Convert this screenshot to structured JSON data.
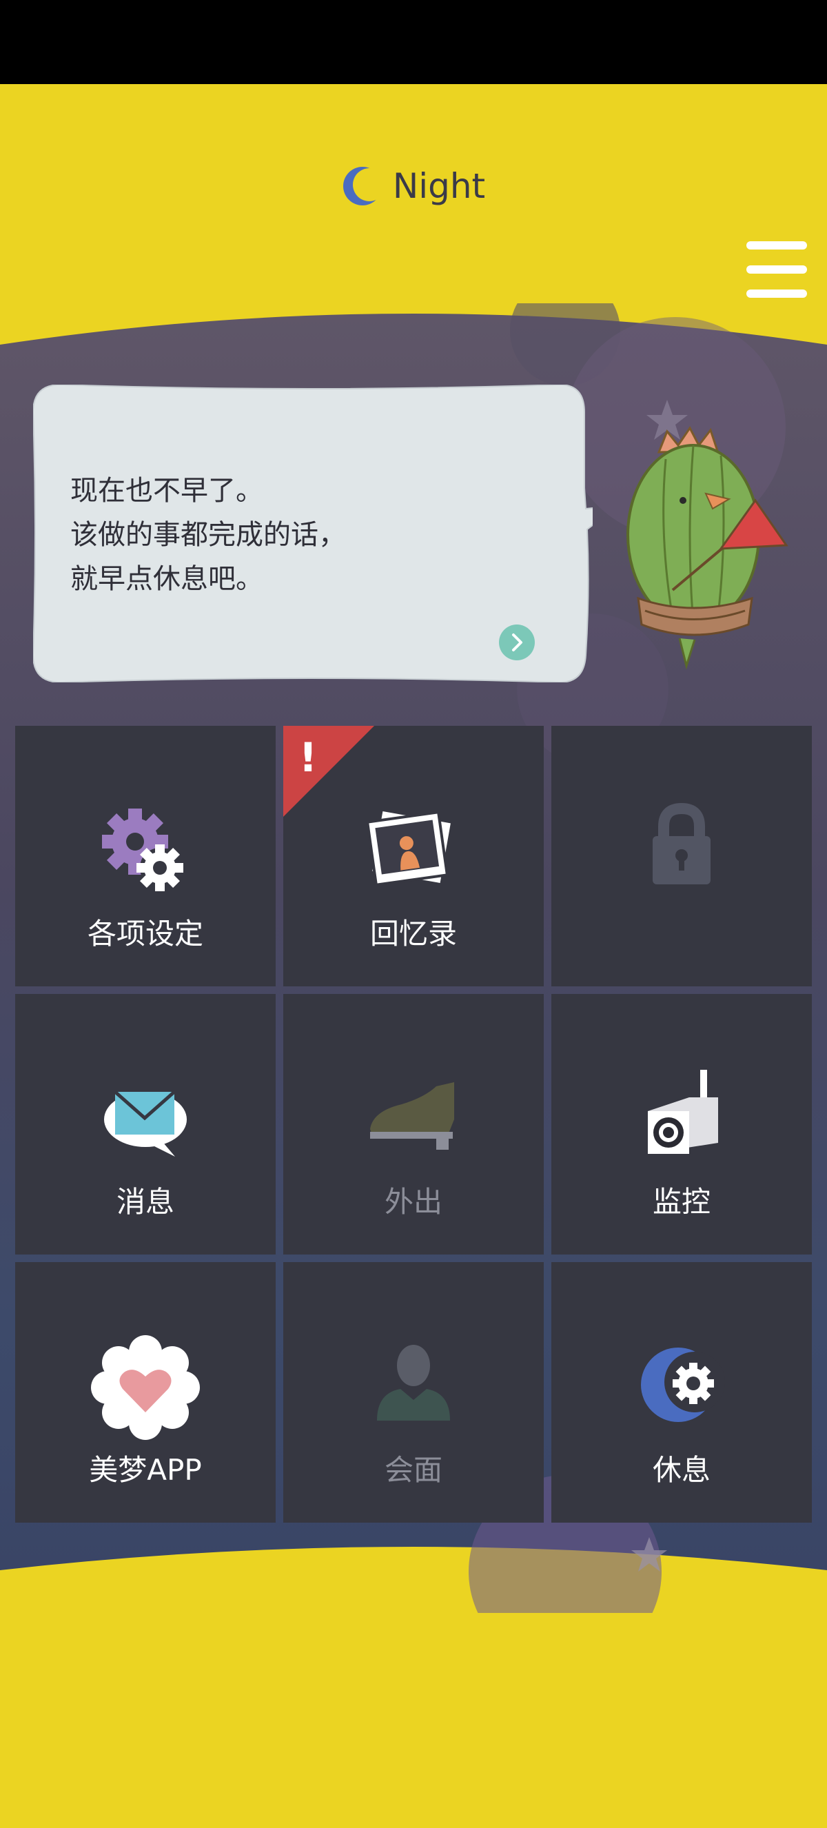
{
  "header": {
    "mode_icon": "crescent-moon-icon",
    "mode_label": "Night",
    "menu_icon": "hamburger-menu-icon"
  },
  "speech": {
    "lines": [
      "现在也不早了。",
      "该做的事都完成的话，",
      "就早点休息吧。"
    ],
    "next_icon": "chevron-right-icon"
  },
  "colors": {
    "background_yellow": "#ebd422",
    "tile_bg": "#363741",
    "bubble_bg": "#e0e6e8",
    "badge_red": "#cc4444",
    "accent_teal": "#7cc8b8"
  },
  "grid": {
    "tiles": [
      {
        "label": "各项设定",
        "icon": "gears-icon",
        "enabled": true,
        "alert": false
      },
      {
        "label": "回忆录",
        "icon": "photos-icon",
        "enabled": true,
        "alert": true
      },
      {
        "label": "",
        "icon": "lock-icon",
        "enabled": false,
        "alert": false
      },
      {
        "label": "消息",
        "icon": "mail-bubble-icon",
        "enabled": true,
        "alert": false
      },
      {
        "label": "外出",
        "icon": "shoe-icon",
        "enabled": false,
        "alert": false
      },
      {
        "label": "监控",
        "icon": "camera-icon",
        "enabled": true,
        "alert": false
      },
      {
        "label": "美梦APP",
        "icon": "heart-flower-icon",
        "enabled": true,
        "alert": false
      },
      {
        "label": "会面",
        "icon": "person-icon",
        "enabled": false,
        "alert": false
      },
      {
        "label": "休息",
        "icon": "moon-gear-icon",
        "enabled": true,
        "alert": false
      }
    ],
    "alert_mark": "!"
  }
}
